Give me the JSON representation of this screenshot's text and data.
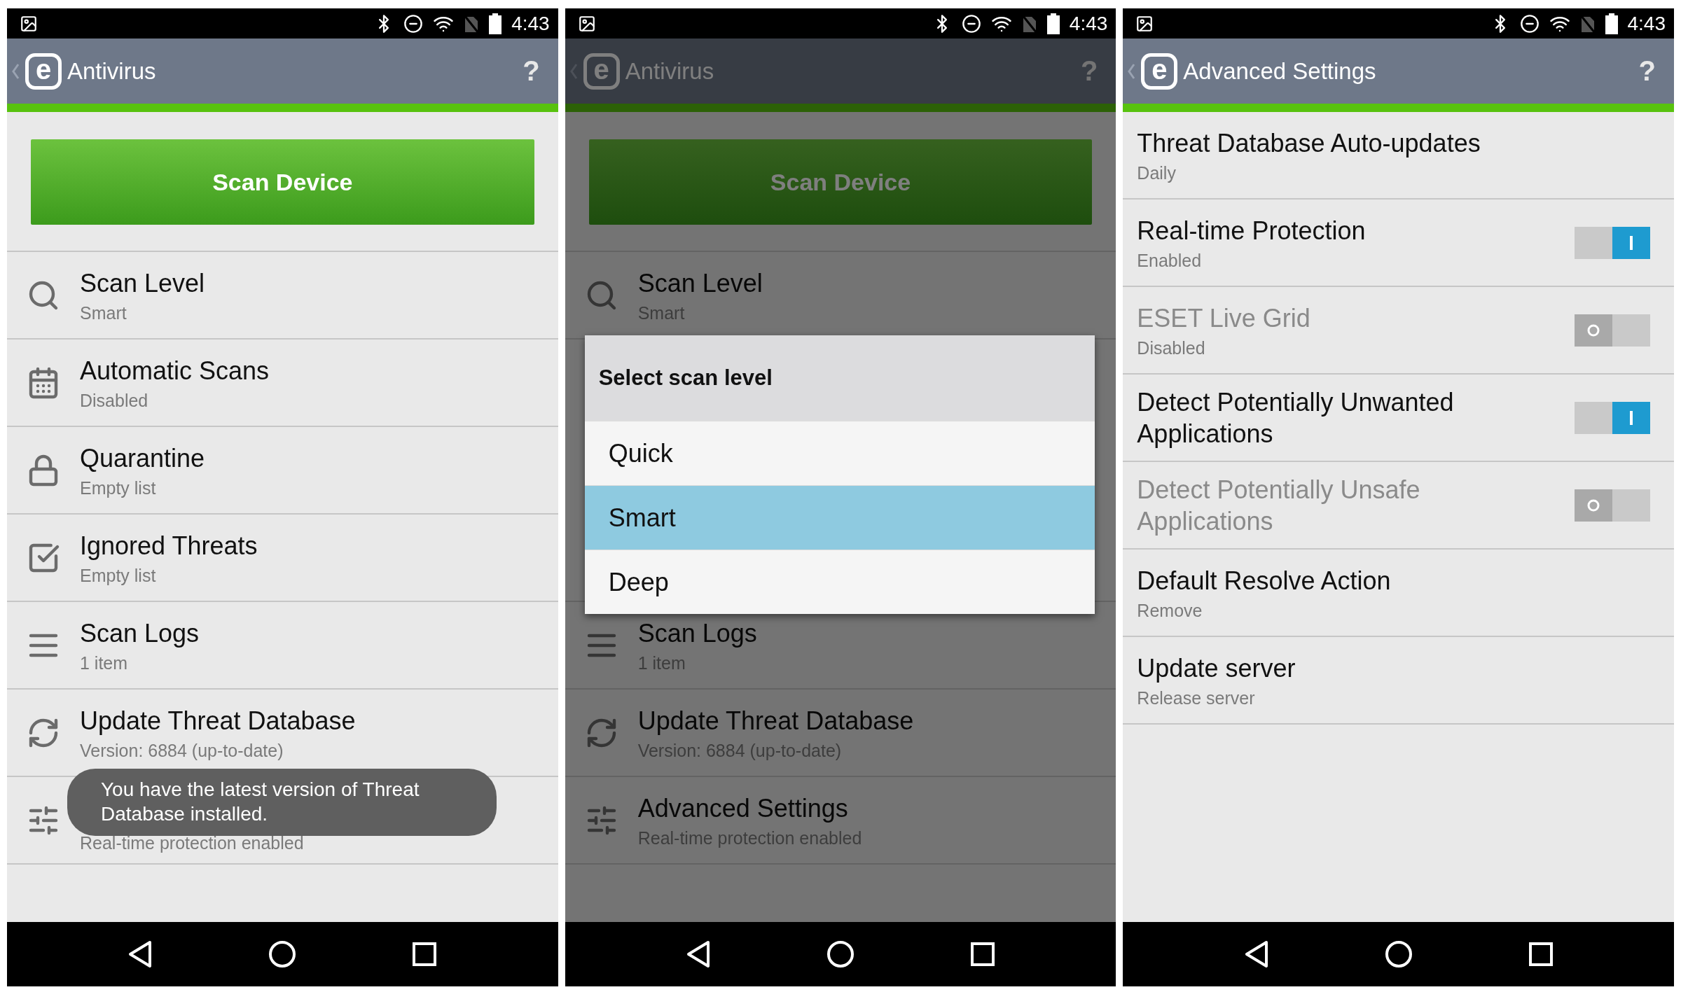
{
  "antivirus_screen": {
    "status_bar": {
      "time": "4:43"
    },
    "header": {
      "logo": "e",
      "title": "Antivirus",
      "help": "?"
    },
    "scan_button": "Scan Device",
    "rows": [
      {
        "kind": "search",
        "title": "Scan Level",
        "subtitle": "Smart"
      },
      {
        "kind": "calendar",
        "title": "Automatic Scans",
        "subtitle": "Disabled"
      },
      {
        "kind": "lock",
        "title": "Quarantine",
        "subtitle": "Empty list"
      },
      {
        "kind": "check",
        "title": "Ignored Threats",
        "subtitle": "Empty list"
      },
      {
        "kind": "log",
        "title": "Scan Logs",
        "subtitle": "1 item"
      },
      {
        "kind": "refresh",
        "title": "Update Threat Database",
        "subtitle": "Version: 6884 (up-to-date)"
      },
      {
        "kind": "sliders",
        "subtitle": "Real-time protection enabled"
      }
    ],
    "toast": "You have the latest version of Threat Database installed."
  },
  "dialog_screen": {
    "status_bar": {
      "time": "4:43"
    },
    "header": {
      "logo": "e",
      "title": "Antivirus",
      "help": "?"
    },
    "scan_button": "Scan Device",
    "rows_above_dialog": [
      {
        "kind": "search",
        "title": "Scan Level",
        "subtitle": "Smart"
      }
    ],
    "rows_below_dialog": [
      {
        "kind": "log",
        "title": "Scan Logs",
        "subtitle": "1 item"
      },
      {
        "kind": "refresh",
        "title": "Update Threat Database",
        "subtitle": "Version: 6884 (up-to-date)"
      },
      {
        "kind": "sliders",
        "title": "Advanced Settings",
        "subtitle": "Real-time protection enabled"
      }
    ],
    "dialog": {
      "title": "Select scan level",
      "options": [
        {
          "label": "Quick",
          "selected": false
        },
        {
          "label": "Smart",
          "selected": true
        },
        {
          "label": "Deep",
          "selected": false
        }
      ]
    }
  },
  "settings_screen": {
    "status_bar": {
      "time": "4:43"
    },
    "header": {
      "logo": "e",
      "title": "Advanced Settings",
      "help": "?"
    },
    "settings": [
      {
        "kind": "plain",
        "title": "Threat Database Auto-updates",
        "subtitle": "Daily"
      },
      {
        "kind": "toggle",
        "title": "Real-time Protection",
        "subtitle": "Enabled",
        "on": true
      },
      {
        "kind": "toggle",
        "title": "ESET Live Grid",
        "subtitle": "Disabled",
        "on": false
      },
      {
        "kind": "toggle",
        "title": "Detect Potentially Unwanted Applications",
        "on": true
      },
      {
        "kind": "toggle",
        "title": "Detect Potentially Unsafe Applications",
        "on": false
      },
      {
        "kind": "plain",
        "title": "Default Resolve Action",
        "subtitle": "Remove"
      },
      {
        "kind": "plain",
        "title": "Update server",
        "subtitle": "Release server"
      }
    ]
  }
}
